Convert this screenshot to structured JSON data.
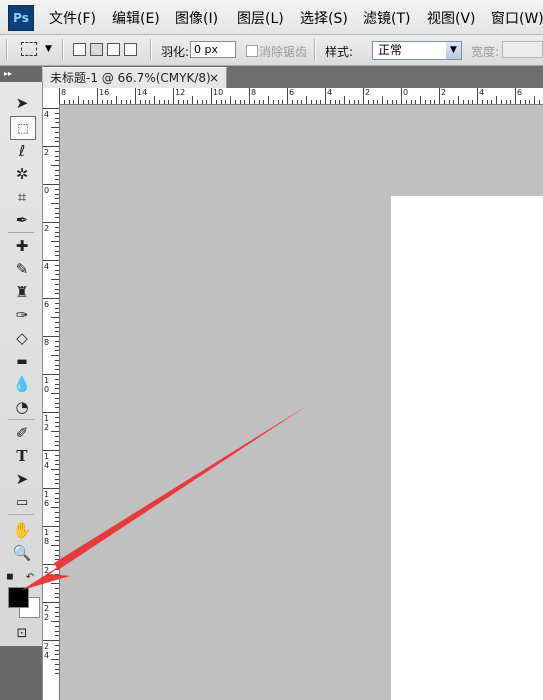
{
  "app": {
    "logo": "Ps"
  },
  "menu": [
    {
      "label": "文件(F)"
    },
    {
      "label": "编辑(E)"
    },
    {
      "label": "图像(I)"
    },
    {
      "label": "图层(L)"
    },
    {
      "label": "选择(S)"
    },
    {
      "label": "滤镜(T)"
    },
    {
      "label": "视图(V)"
    },
    {
      "label": "窗口(W)"
    }
  ],
  "options_bar": {
    "feather_label": "羽化:",
    "feather_value": "0 px",
    "antialias_label": "消除锯齿",
    "style_label": "样式:",
    "style_value": "正常",
    "width_label": "宽度:"
  },
  "document": {
    "tab_title": "未标题-1 @ 66.7%(CMYK/8)",
    "close_symbol": "×"
  },
  "toolbox": {
    "collapse_symbol": "▸▸"
  },
  "ruler": {
    "top_labels": [
      "8",
      "16",
      "14",
      "12",
      "10",
      "8",
      "6",
      "4",
      "2",
      "0",
      "2",
      "4",
      "6"
    ],
    "left_labels": [
      "4",
      "2",
      "0",
      "2",
      "4",
      "6",
      "8",
      "1 0",
      "1 2",
      "1 4",
      "1 6",
      "1 8",
      "2 0",
      "2 2",
      "2 4"
    ]
  },
  "colors": {
    "arrow": "#e8393b",
    "canvas": "#c0c0c0",
    "page": "#ffffff",
    "foreground": "#000000",
    "background": "#ffffff"
  }
}
